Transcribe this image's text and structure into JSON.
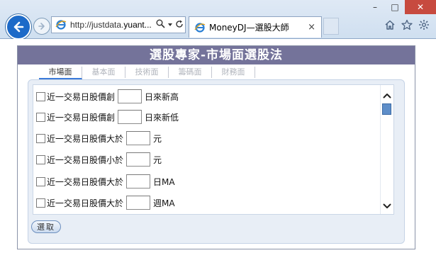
{
  "browser": {
    "url_plain": "http://justdata.",
    "url_domain": "yuant...",
    "tab_title": "MoneyDJ—選股大師",
    "tab_close": "×",
    "window_controls": {
      "minimize": "–",
      "maximize": "□",
      "close": "✕"
    },
    "toolbar_icons": [
      "home-icon",
      "star-icon",
      "gear-icon"
    ]
  },
  "page": {
    "title": "選股專家-市場面選股法",
    "tabs": [
      {
        "label": "市場面",
        "active": true
      },
      {
        "label": "基本面",
        "active": false
      },
      {
        "label": "技術面",
        "active": false
      },
      {
        "label": "籌碼面",
        "active": false
      },
      {
        "label": "財務面",
        "active": false
      }
    ],
    "criteria": [
      {
        "before": "近一交易日股價創",
        "after": "日來新高",
        "value": ""
      },
      {
        "before": "近一交易日股價創",
        "after": "日來新低",
        "value": ""
      },
      {
        "before": "近一交易日股價大於",
        "after": "元",
        "value": ""
      },
      {
        "before": "近一交易日股價小於",
        "after": "元",
        "value": ""
      },
      {
        "before": "近一交易日股價大於",
        "after": "日MA",
        "value": ""
      },
      {
        "before": "近一交易日股價大於",
        "after": "週MA",
        "value": ""
      }
    ],
    "select_button": "選取"
  },
  "colors": {
    "header_bg": "#74739a",
    "tab_active_underline": "#3b7ad9",
    "panel_bg": "#e8eef6",
    "back_button": "#1d6ac8",
    "close_button": "#c74a3f"
  }
}
